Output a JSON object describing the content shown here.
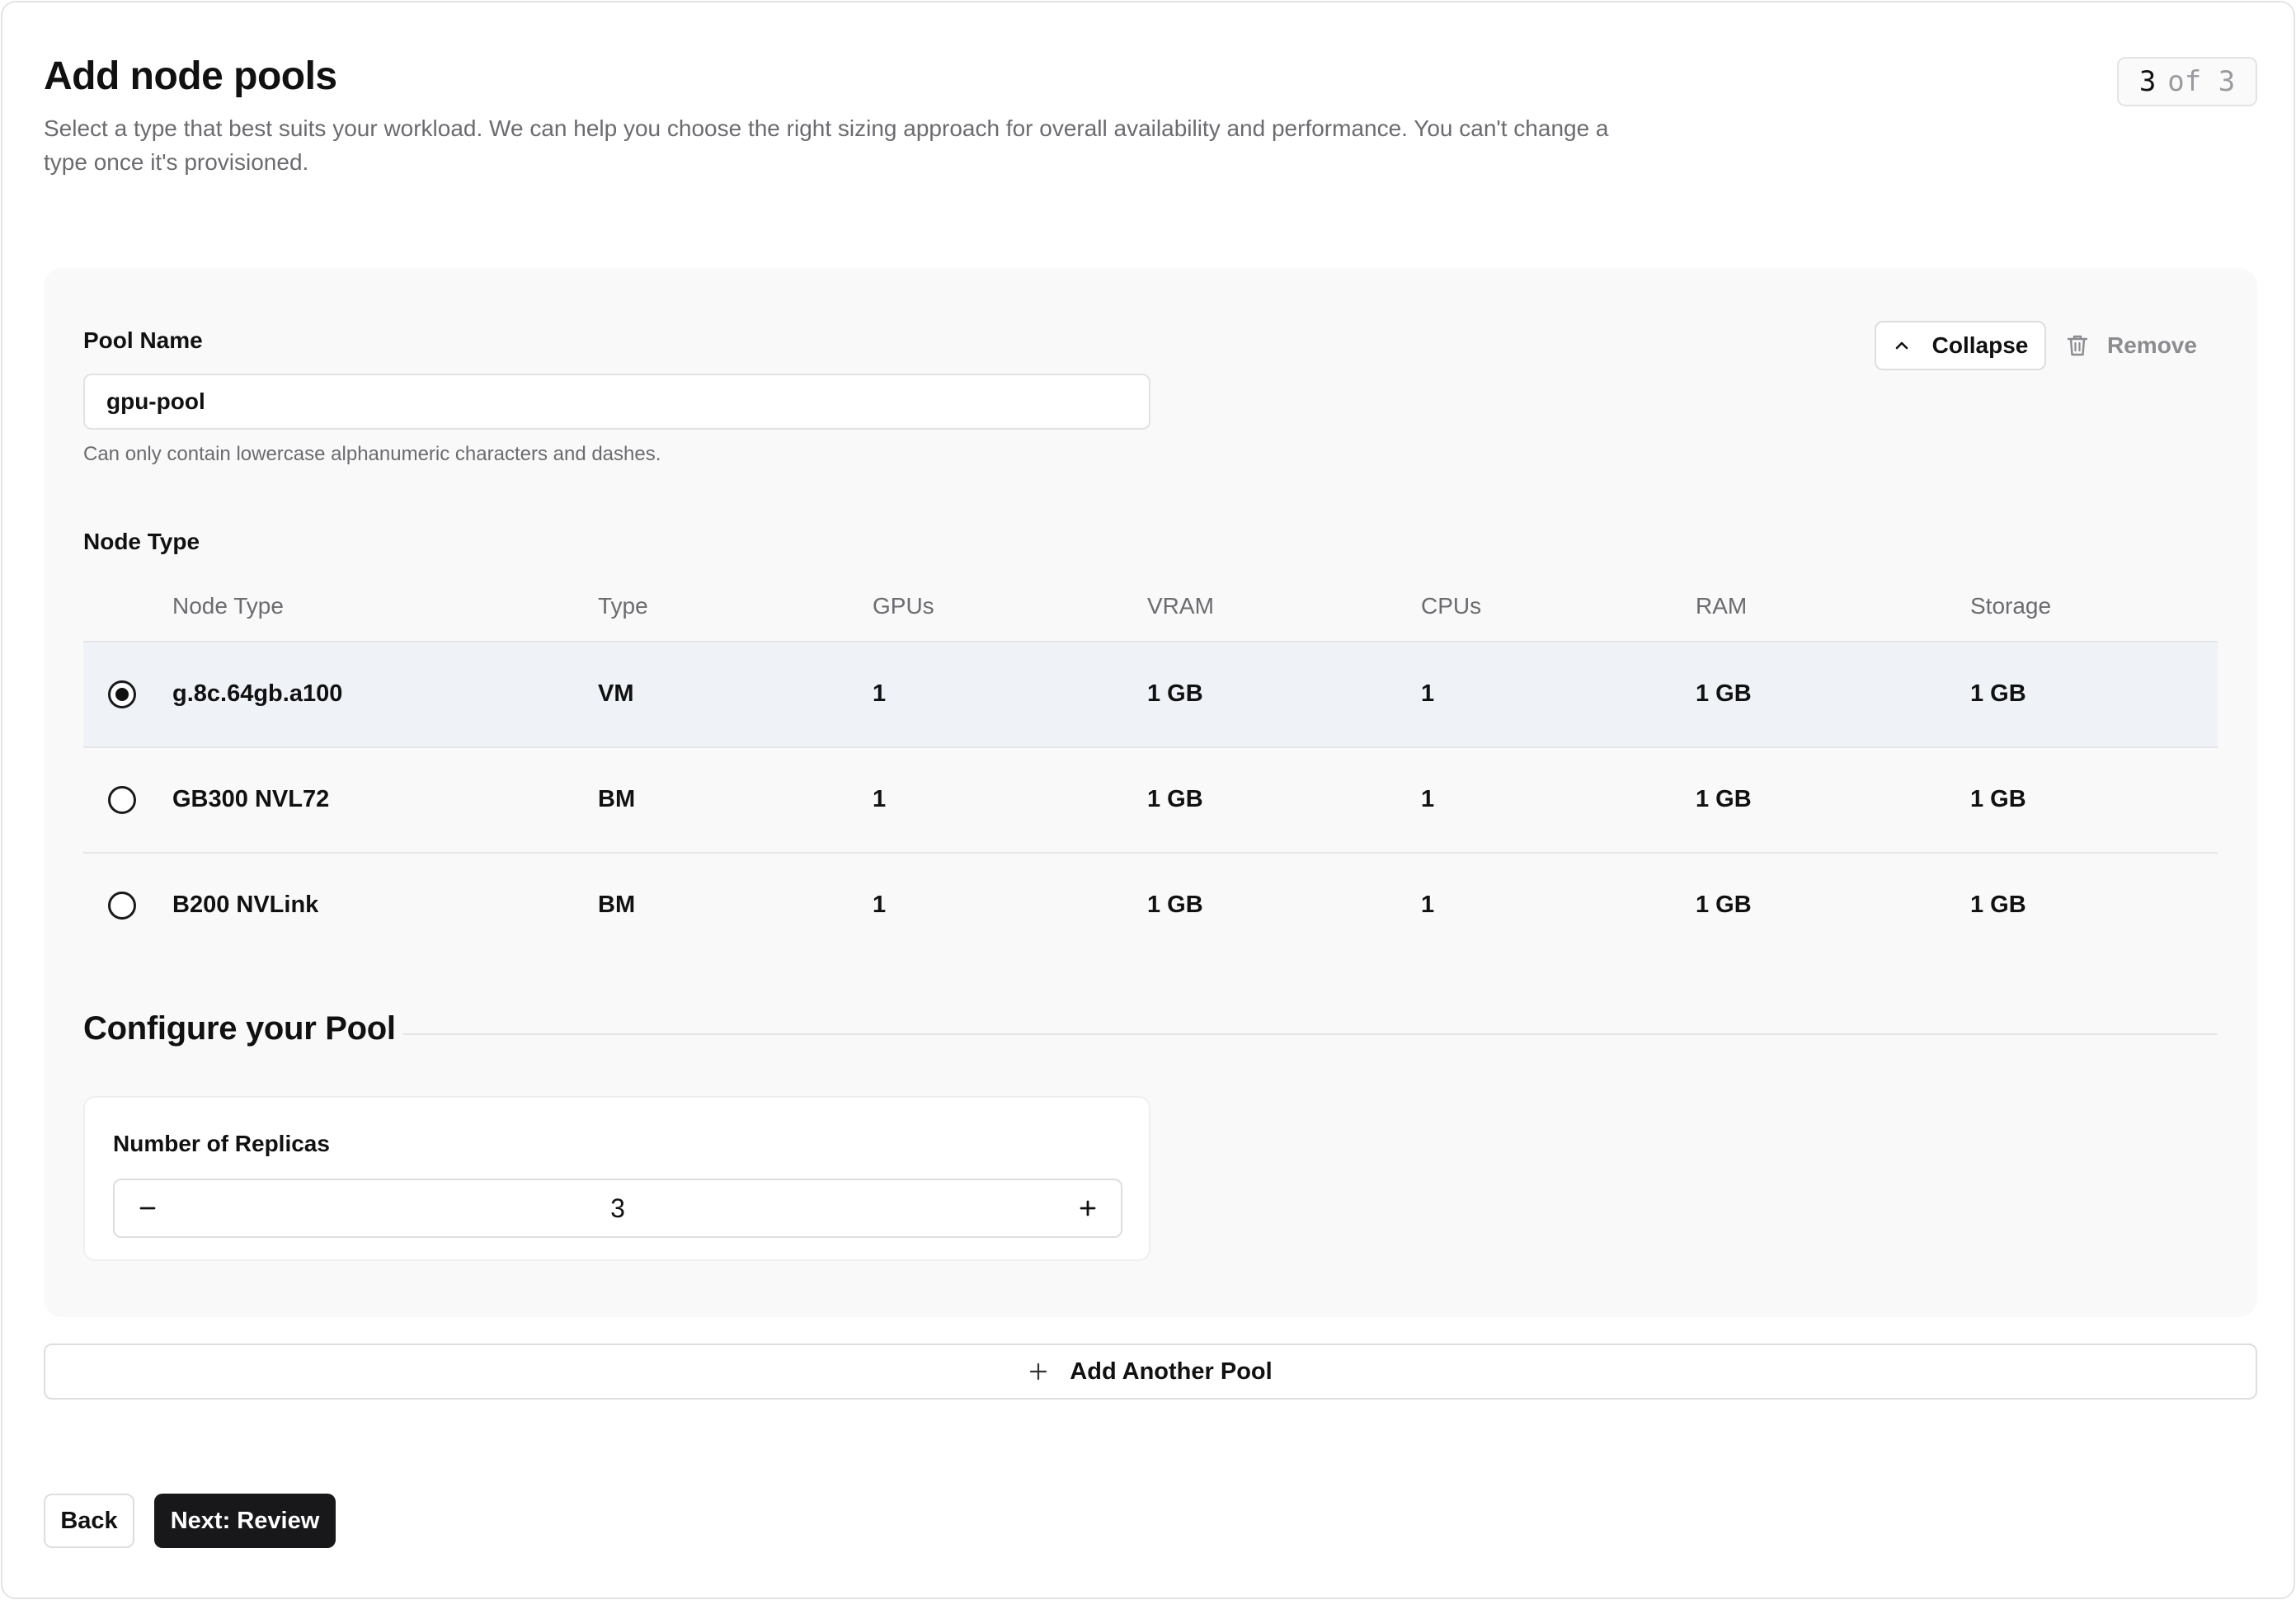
{
  "header": {
    "title": "Add node pools",
    "subtitle": "Select a type that best suits your workload. We can help you choose the right sizing approach for overall availability and performance. You can't change a type once it's provisioned.",
    "step_current": "3",
    "step_total_text": "of 3"
  },
  "pool": {
    "name_label": "Pool Name",
    "name_value": "gpu-pool",
    "name_hint": "Can only contain lowercase alphanumeric characters and dashes.",
    "collapse_label": "Collapse",
    "remove_label": "Remove",
    "node_type_label": "Node Type",
    "table": {
      "columns": [
        "Node Type",
        "Type",
        "GPUs",
        "VRAM",
        "CPUs",
        "RAM",
        "Storage"
      ],
      "rows": [
        {
          "selected": true,
          "cells": [
            "g.8c.64gb.a100",
            "VM",
            "1",
            "1 GB",
            "1",
            "1 GB",
            "1 GB"
          ]
        },
        {
          "selected": false,
          "cells": [
            "GB300 NVL72",
            "BM",
            "1",
            "1 GB",
            "1",
            "1 GB",
            "1 GB"
          ]
        },
        {
          "selected": false,
          "cells": [
            "B200 NVLink",
            "BM",
            "1",
            "1 GB",
            "1",
            "1 GB",
            "1 GB"
          ]
        }
      ]
    },
    "configure_title": "Configure your Pool",
    "replicas_label": "Number of Replicas",
    "replicas_value": "3"
  },
  "actions": {
    "add_pool_label": "Add Another Pool",
    "back_label": "Back",
    "next_label": "Next: Review"
  },
  "icons": {
    "collapse": "chevron-up-icon",
    "remove": "trash-icon",
    "add_pool": "plus-icon",
    "decrement": "minus-icon",
    "increment": "plus-icon"
  },
  "colors": {
    "primary_button": "#18181b",
    "selected_row": "#eff3f8",
    "card_background": "#f9f9f9"
  }
}
